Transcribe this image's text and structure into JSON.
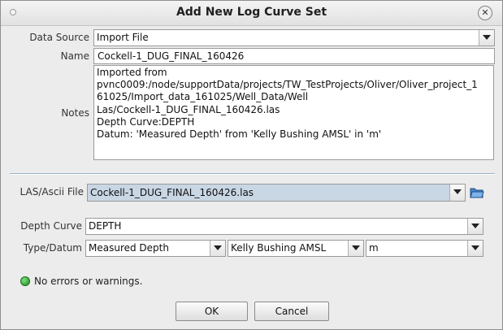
{
  "window": {
    "title": "Add New Log Curve Set"
  },
  "form": {
    "data_source_label": "Data Source",
    "data_source_value": "Import File",
    "name_label": "Name",
    "name_value": "Cockell-1_DUG_FINAL_160426",
    "notes_label": "Notes",
    "notes_value": "Imported from\npvnc0009:/node/supportData/projects/TW_TestProjects/Oliver/Oliver_project_1\n61025/Import_data_161025/Well_Data/Well\nLas/Cockell-1_DUG_FINAL_160426.las\nDepth Curve:DEPTH\nDatum: 'Measured Depth' from 'Kelly Bushing AMSL' in 'm'",
    "las_file_label": "LAS/Ascii File",
    "las_file_value": "Cockell-1_DUG_FINAL_160426.las",
    "depth_curve_label": "Depth Curve",
    "depth_curve_value": "DEPTH",
    "type_datum_label": "Type/Datum",
    "type_value": "Measured Depth",
    "datum_value": "Kelly Bushing AMSL",
    "unit_value": "m"
  },
  "status": {
    "text": "No errors or warnings.",
    "color": "#2aa52a"
  },
  "buttons": {
    "ok": "OK",
    "cancel": "Cancel"
  },
  "icons": {
    "window": "window-menu-icon",
    "close": "close-icon",
    "browse": "open-folder-icon",
    "status": "status-ok-icon"
  }
}
